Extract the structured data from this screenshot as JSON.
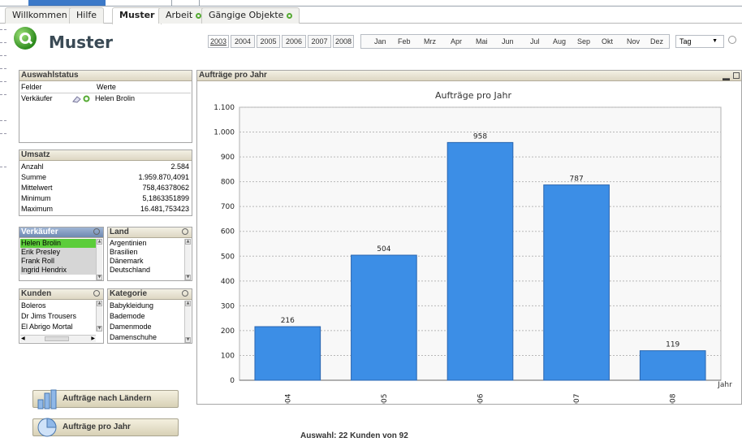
{
  "tabs": [
    {
      "label": "Willkommen",
      "active": false,
      "dot": false
    },
    {
      "label": "Hilfe",
      "active": false,
      "dot": false
    },
    {
      "label": "Muster",
      "active": true,
      "dot": false
    },
    {
      "label": "Arbeit",
      "active": false,
      "dot": true
    },
    {
      "label": "Gängige Objekte",
      "active": false,
      "dot": true
    }
  ],
  "sheet": {
    "title": "Muster"
  },
  "years": [
    "2003",
    "2004",
    "2005",
    "2006",
    "2007",
    "2008"
  ],
  "selected_year": "2003",
  "months": [
    "Jan",
    "Feb",
    "Mrz",
    "Apr",
    "Mai",
    "Jun",
    "Jul",
    "Aug",
    "Sep",
    "Okt",
    "Nov",
    "Dez"
  ],
  "day_select": {
    "value": "Tag"
  },
  "current_selections": {
    "title": "Auswahlstatus",
    "col_fields": "Felder",
    "col_values": "Werte",
    "field": "Verkäufer",
    "value": "Helen Brolin"
  },
  "umsatz": {
    "title": "Umsatz",
    "rows": [
      {
        "label": "Anzahl",
        "value": "2.584"
      },
      {
        "label": "Summe",
        "value": "1.959.870,4091"
      },
      {
        "label": "Mittelwert",
        "value": "758,46378062"
      },
      {
        "label": "Minimum",
        "value": "5,1863351899"
      },
      {
        "label": "Maximum",
        "value": "16.481,753423"
      }
    ]
  },
  "listboxes": {
    "verkaeufer": {
      "title": "Verkäufer",
      "items": [
        "Helen Brolin",
        "Erik Presley",
        "Frank Roll",
        "Ingrid Hendrix"
      ],
      "selected": 0
    },
    "land": {
      "title": "Land",
      "items": [
        "Argentinien",
        "Brasilien",
        "Dänemark",
        "Deutschland"
      ]
    },
    "kunden": {
      "title": "Kunden",
      "items": [
        "Boleros",
        "Dr Jims Trousers",
        "El Abrigo Mortal"
      ]
    },
    "kategorie": {
      "title": "Kategorie",
      "items": [
        "Babykleidung",
        "Bademode",
        "Damenmode",
        "Damenschuhe"
      ]
    }
  },
  "buttons": {
    "laender": "Aufträge nach Ländern",
    "jahr": "Aufträge pro Jahr"
  },
  "chart_box": {
    "caption": "Aufträge pro Jahr"
  },
  "chart_data": {
    "type": "bar",
    "title": "Aufträge pro Jahr",
    "xlabel": "Jahr",
    "ylabel": "",
    "categories": [
      "2004",
      "2005",
      "2006",
      "2007",
      "2008"
    ],
    "values": [
      216,
      504,
      958,
      787,
      119
    ],
    "ylim": [
      0,
      1100
    ],
    "yticks": [
      0,
      100,
      200,
      300,
      400,
      500,
      600,
      700,
      800,
      900,
      1000,
      1100
    ],
    "ytick_labels": [
      "0",
      "100",
      "200",
      "300",
      "400",
      "500",
      "600",
      "700",
      "800",
      "900",
      "1.000",
      "1.100"
    ],
    "grid": true,
    "bar_color": "#3c8ee6"
  },
  "status": {
    "text": "Auswahl: 22 Kunden von 92"
  }
}
